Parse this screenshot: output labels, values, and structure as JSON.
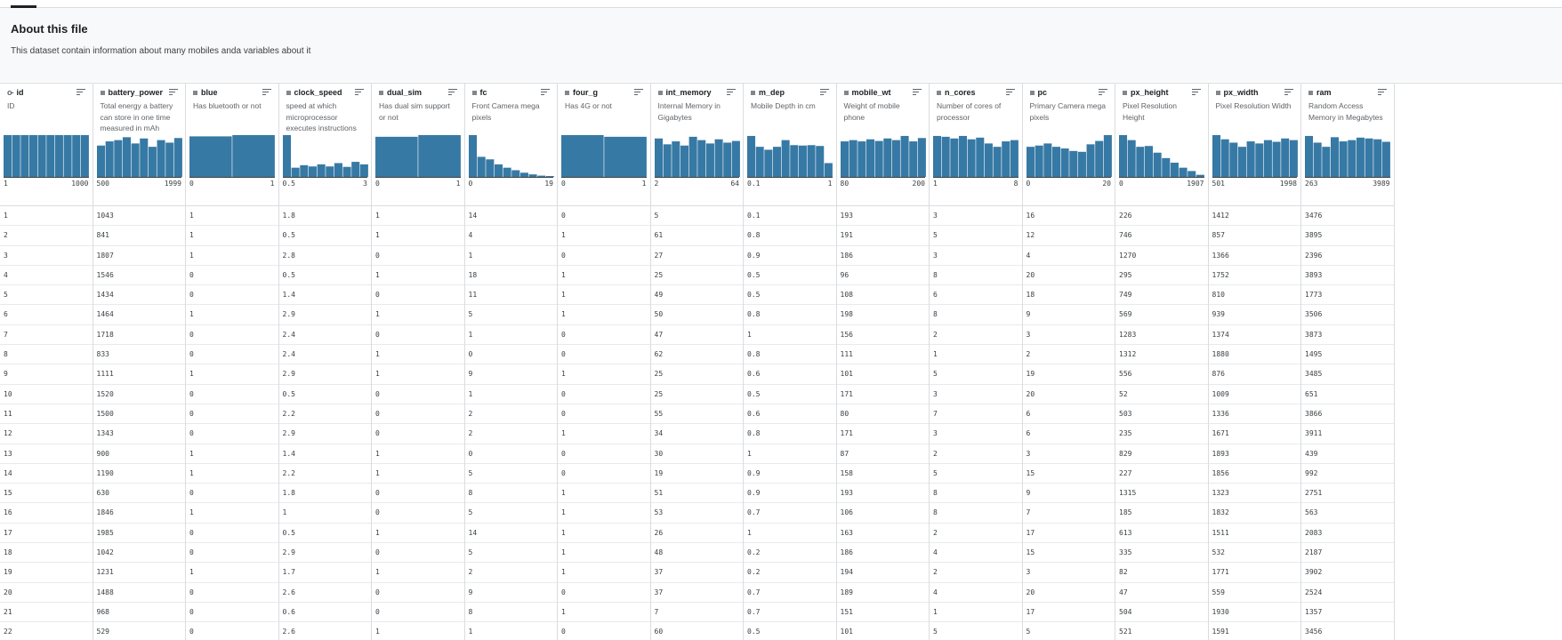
{
  "about": {
    "title": "About this file",
    "description": "This dataset contain information about many mobiles anda variables about it"
  },
  "columns": [
    {
      "name": "id",
      "icon": "key-icon",
      "description": "ID",
      "min": "1",
      "max": "1000",
      "bins": [
        1,
        1,
        1,
        1,
        1,
        1,
        1,
        1,
        1,
        1
      ],
      "values": [
        "1",
        "2",
        "3",
        "4",
        "5",
        "6",
        "7",
        "8",
        "9",
        "10",
        "11",
        "12",
        "13",
        "14",
        "15",
        "16",
        "17",
        "18",
        "19",
        "20",
        "21",
        "22"
      ]
    },
    {
      "name": "battery_power",
      "icon": "numeric-icon",
      "description": "Total energy a battery can store in one time measured in mAh",
      "min": "500",
      "max": "1999",
      "bins": [
        0.75,
        0.85,
        0.88,
        0.95,
        0.8,
        0.92,
        0.72,
        0.88,
        0.82,
        0.93
      ],
      "values": [
        "1043",
        "841",
        "1807",
        "1546",
        "1434",
        "1464",
        "1718",
        "833",
        "1111",
        "1520",
        "1500",
        "1343",
        "900",
        "1190",
        "630",
        "1846",
        "1985",
        "1042",
        "1231",
        "1488",
        "968",
        "529"
      ]
    },
    {
      "name": "blue",
      "icon": "numeric-icon",
      "description": "Has bluetooth or not",
      "min": "0",
      "max": "1",
      "bins": [
        0.97,
        1.0
      ],
      "values": [
        "1",
        "1",
        "1",
        "0",
        "0",
        "1",
        "0",
        "0",
        "1",
        "0",
        "0",
        "0",
        "1",
        "1",
        "0",
        "1",
        "0",
        "0",
        "1",
        "0",
        "0",
        "0"
      ]
    },
    {
      "name": "clock_speed",
      "icon": "numeric-icon",
      "description": "speed at which microprocessor executes instructions",
      "min": "0.5",
      "max": "3",
      "bins": [
        1.0,
        0.22,
        0.28,
        0.25,
        0.3,
        0.25,
        0.33,
        0.24,
        0.36,
        0.3
      ],
      "values": [
        "1.8",
        "0.5",
        "2.8",
        "0.5",
        "1.4",
        "2.9",
        "2.4",
        "2.4",
        "2.9",
        "0.5",
        "2.2",
        "2.9",
        "1.4",
        "2.2",
        "1.8",
        "1",
        "0.5",
        "2.9",
        "1.7",
        "2.6",
        "0.6",
        "2.6"
      ]
    },
    {
      "name": "dual_sim",
      "icon": "numeric-icon",
      "description": "Has dual sim support or not",
      "min": "0",
      "max": "1",
      "bins": [
        0.96,
        1.0
      ],
      "values": [
        "1",
        "1",
        "0",
        "1",
        "0",
        "1",
        "0",
        "1",
        "1",
        "0",
        "0",
        "0",
        "1",
        "1",
        "0",
        "0",
        "1",
        "0",
        "1",
        "0",
        "0",
        "1"
      ]
    },
    {
      "name": "fc",
      "icon": "numeric-icon",
      "description": "Front Camera mega pixels",
      "min": "0",
      "max": "19",
      "bins": [
        1.0,
        0.48,
        0.42,
        0.3,
        0.22,
        0.16,
        0.1,
        0.06,
        0.03,
        0.02
      ],
      "values": [
        "14",
        "4",
        "1",
        "18",
        "11",
        "5",
        "1",
        "0",
        "9",
        "1",
        "2",
        "2",
        "0",
        "5",
        "8",
        "5",
        "14",
        "5",
        "2",
        "9",
        "8",
        "1"
      ]
    },
    {
      "name": "four_g",
      "icon": "numeric-icon",
      "description": "Has 4G or not",
      "min": "0",
      "max": "1",
      "bins": [
        1.0,
        0.96
      ],
      "values": [
        "0",
        "1",
        "0",
        "1",
        "1",
        "1",
        "0",
        "0",
        "1",
        "0",
        "0",
        "1",
        "0",
        "0",
        "1",
        "1",
        "1",
        "1",
        "1",
        "0",
        "1",
        "0"
      ]
    },
    {
      "name": "int_memory",
      "icon": "numeric-icon",
      "description": "Internal Memory in Gigabytes",
      "min": "2",
      "max": "64",
      "bins": [
        0.92,
        0.78,
        0.85,
        0.75,
        0.96,
        0.88,
        0.8,
        0.9,
        0.82,
        0.86
      ],
      "values": [
        "5",
        "61",
        "27",
        "25",
        "49",
        "50",
        "47",
        "62",
        "25",
        "25",
        "55",
        "34",
        "30",
        "19",
        "51",
        "53",
        "26",
        "48",
        "37",
        "37",
        "7",
        "60"
      ]
    },
    {
      "name": "m_dep",
      "icon": "numeric-icon",
      "description": "Mobile Depth in cm",
      "min": "0.1",
      "max": "1",
      "bins": [
        0.98,
        0.72,
        0.65,
        0.72,
        0.88,
        0.76,
        0.75,
        0.76,
        0.74,
        0.33
      ],
      "values": [
        "0.1",
        "0.8",
        "0.9",
        "0.5",
        "0.5",
        "0.8",
        "1",
        "0.8",
        "0.6",
        "0.5",
        "0.6",
        "0.8",
        "1",
        "0.9",
        "0.9",
        "0.7",
        "1",
        "0.2",
        "0.2",
        "0.7",
        "0.7",
        "0.5"
      ]
    },
    {
      "name": "mobile_wt",
      "icon": "numeric-icon",
      "description": "Weight of mobile phone",
      "min": "80",
      "max": "200",
      "bins": [
        0.85,
        0.88,
        0.85,
        0.9,
        0.86,
        0.92,
        0.88,
        0.98,
        0.85,
        0.93
      ],
      "values": [
        "193",
        "191",
        "186",
        "96",
        "108",
        "198",
        "156",
        "111",
        "101",
        "171",
        "80",
        "171",
        "87",
        "158",
        "193",
        "106",
        "163",
        "186",
        "194",
        "189",
        "151",
        "101"
      ]
    },
    {
      "name": "n_cores",
      "icon": "numeric-icon",
      "description": "Number of cores of processor",
      "min": "1",
      "max": "8",
      "bins": [
        0.98,
        0.96,
        0.92,
        0.98,
        0.9,
        0.94,
        0.8,
        0.72,
        0.85,
        0.88
      ],
      "values": [
        "3",
        "5",
        "3",
        "8",
        "6",
        "8",
        "2",
        "1",
        "5",
        "3",
        "7",
        "3",
        "2",
        "5",
        "8",
        "8",
        "2",
        "4",
        "2",
        "4",
        "1",
        "5"
      ]
    },
    {
      "name": "pc",
      "icon": "numeric-icon",
      "description": "Primary Camera mega pixels",
      "min": "0",
      "max": "20",
      "bins": [
        0.72,
        0.75,
        0.8,
        0.72,
        0.68,
        0.62,
        0.6,
        0.78,
        0.86,
        1.0
      ],
      "values": [
        "16",
        "12",
        "4",
        "20",
        "18",
        "9",
        "3",
        "2",
        "19",
        "20",
        "6",
        "6",
        "3",
        "15",
        "9",
        "7",
        "17",
        "15",
        "3",
        "20",
        "17",
        "5"
      ]
    },
    {
      "name": "px_height",
      "icon": "numeric-icon",
      "description": "Pixel Resolution Height",
      "min": "0",
      "max": "1907",
      "bins": [
        1.0,
        0.88,
        0.72,
        0.74,
        0.58,
        0.45,
        0.34,
        0.22,
        0.14,
        0.05
      ],
      "values": [
        "226",
        "746",
        "1270",
        "295",
        "749",
        "569",
        "1283",
        "1312",
        "556",
        "52",
        "503",
        "235",
        "829",
        "227",
        "1315",
        "185",
        "613",
        "335",
        "82",
        "47",
        "504",
        "521"
      ]
    },
    {
      "name": "px_width",
      "icon": "numeric-icon",
      "description": "Pixel Resolution Width",
      "min": "501",
      "max": "1998",
      "bins": [
        1.0,
        0.9,
        0.82,
        0.72,
        0.85,
        0.8,
        0.88,
        0.84,
        0.92,
        0.88
      ],
      "values": [
        "1412",
        "857",
        "1366",
        "1752",
        "810",
        "939",
        "1374",
        "1880",
        "876",
        "1009",
        "1336",
        "1671",
        "1893",
        "1856",
        "1323",
        "1832",
        "1511",
        "532",
        "1771",
        "559",
        "1930",
        "1591"
      ]
    },
    {
      "name": "ram",
      "icon": "numeric-icon",
      "description": "Random Access Memory in Megabytes",
      "min": "263",
      "max": "3989",
      "bins": [
        0.98,
        0.82,
        0.72,
        0.95,
        0.85,
        0.88,
        0.94,
        0.92,
        0.9,
        0.84
      ],
      "values": [
        "3476",
        "3895",
        "2396",
        "3893",
        "1773",
        "3506",
        "3873",
        "1495",
        "3485",
        "651",
        "3866",
        "3911",
        "439",
        "992",
        "2751",
        "563",
        "2083",
        "2187",
        "3902",
        "2524",
        "1357",
        "3456"
      ]
    }
  ]
}
